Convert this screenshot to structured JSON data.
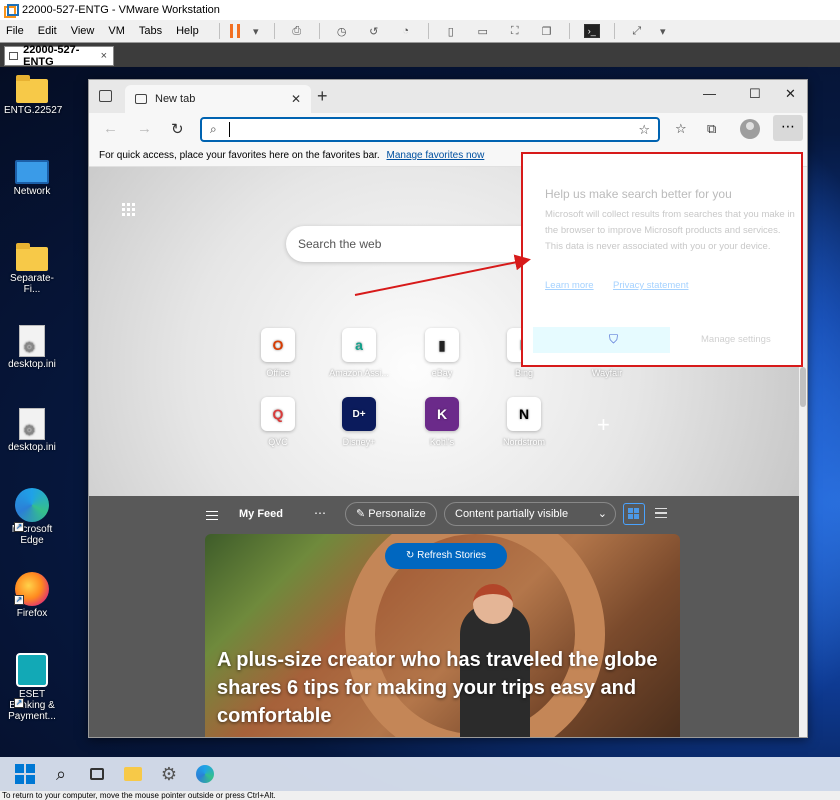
{
  "vmware": {
    "title": "22000-527-ENTG - VMware Workstation",
    "menu": [
      "File",
      "Edit",
      "View",
      "VM",
      "Tabs",
      "Help"
    ],
    "tab_label": "22000-527-ENTG",
    "status": "To return to your computer, move the mouse pointer outside or press Ctrl+Alt."
  },
  "desktop": {
    "icons": [
      {
        "label": "ENTG.22527",
        "kind": "folder-icon"
      },
      {
        "label": "Network",
        "kind": "network-icon"
      },
      {
        "label": "Separate-Fi...",
        "kind": "folder-icon"
      },
      {
        "label": "desktop.ini",
        "kind": "settings-file-icon"
      },
      {
        "label": "desktop.ini",
        "kind": "settings-file-icon"
      },
      {
        "label": "Microsoft Edge",
        "kind": "edge-icon"
      },
      {
        "label": "Firefox",
        "kind": "firefox-icon"
      },
      {
        "label": "ESET Banking & Payment...",
        "kind": "eset-icon"
      }
    ]
  },
  "edge": {
    "tab_title": "New tab",
    "favorites_hint": "For quick access, place your favorites here on the favorites bar.",
    "manage_favorites": "Manage favorites now",
    "search_placeholder": "Search the web",
    "tiles": [
      {
        "label": "Office",
        "glyph": "O",
        "color": "#d83b01"
      },
      {
        "label": "Amazon Assi...",
        "glyph": "a",
        "color": "#12a08a"
      },
      {
        "label": "eBay",
        "glyph": "▮",
        "color": "#222222"
      },
      {
        "label": "Bing",
        "glyph": "b",
        "color": "#008373"
      },
      {
        "label": "Wayfair",
        "glyph": "◆",
        "color": "#7b189f"
      },
      {
        "label": "QVC",
        "glyph": "Q",
        "color": "#d93a3a"
      },
      {
        "label": "Disney+",
        "glyph": "D+",
        "color": "#0b1b5c"
      },
      {
        "label": "Kohl's",
        "glyph": "K",
        "color": "#6b2a8a"
      },
      {
        "label": "Nordstrom",
        "glyph": "N",
        "color": "#000000"
      }
    ],
    "feed": {
      "title": "My Feed",
      "personalize": "Personalize",
      "visibility": "Content partially visible",
      "refresh": "Refresh Stories",
      "headline": "A plus-size creator who has traveled the globe shares 6 tips for making your trips easy and comfortable"
    },
    "popup": {
      "title": "Help us make search better for you",
      "body": "Microsoft will collect results from searches that you make in the browser to improve Microsoft products and services. This data is never associated with you or your device.",
      "learn_more": "Learn more",
      "privacy": "Privacy statement",
      "manage": "Manage settings"
    }
  },
  "colors": {
    "accent": "#0063b1",
    "callout": "#d71a1a"
  }
}
